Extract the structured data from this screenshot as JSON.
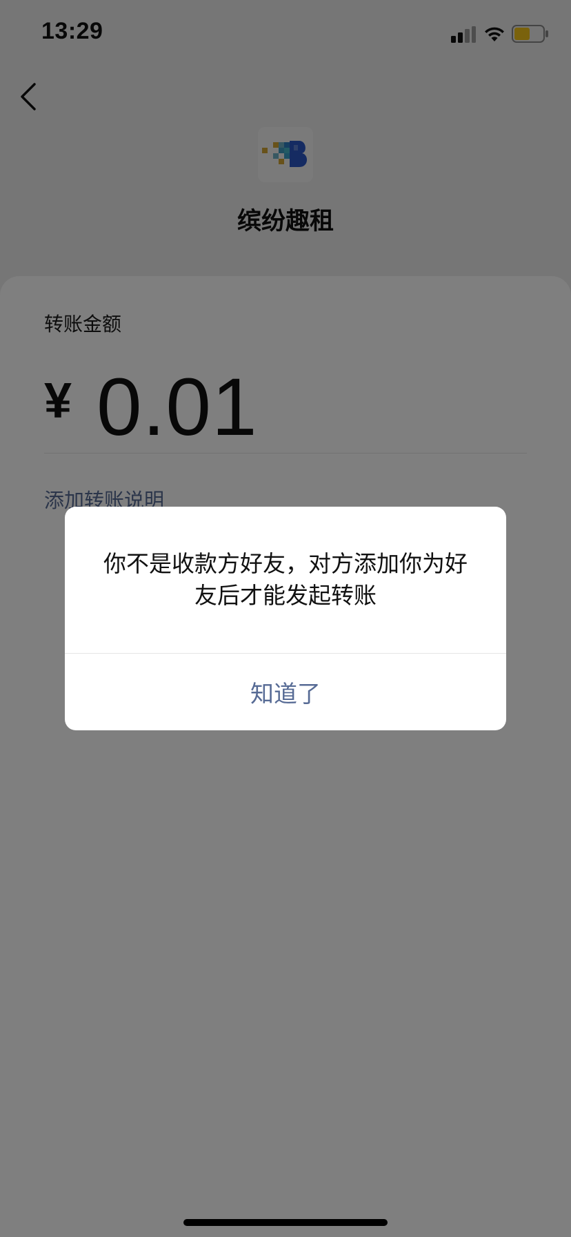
{
  "status_bar": {
    "time": "13:29",
    "icons": [
      "signal-icon",
      "wifi-icon",
      "battery-icon"
    ],
    "battery_color": "#f5c518"
  },
  "nav": {
    "back_icon": "back-chevron-icon"
  },
  "payee": {
    "name": "缤纷趣租",
    "avatar_icon": "pixel-b-logo"
  },
  "transfer": {
    "amount_label": "转账金额",
    "currency_symbol": "¥",
    "amount": "0.01",
    "add_note_label": "添加转账说明"
  },
  "dialog": {
    "message": "你不是收款方好友，对方添加你为好友后才能发起转账",
    "confirm_label": "知道了"
  },
  "colors": {
    "link": "#576b95",
    "overlay": "rgba(0,0,0,0.5)"
  }
}
